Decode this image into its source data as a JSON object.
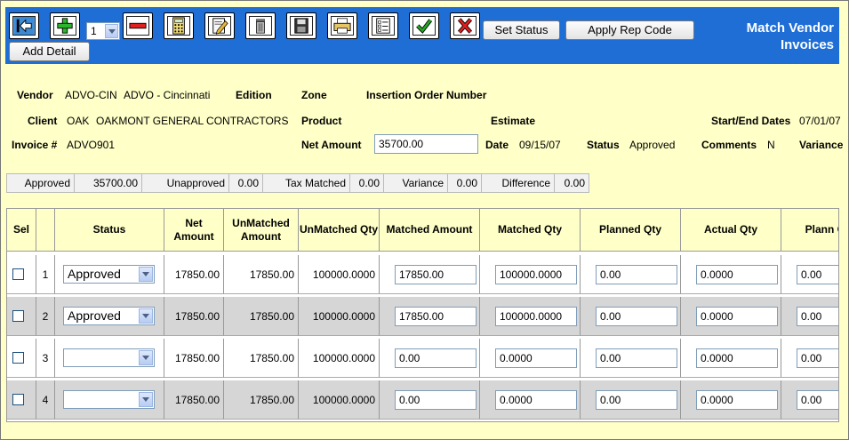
{
  "toolbar": {
    "record_select_value": "1",
    "set_status_label": "Set Status",
    "apply_rep_code_label": "Apply Rep Code",
    "add_detail_label": "Add Detail",
    "title_line1": "Match Vendor",
    "title_line2": "Invoices",
    "icons": [
      "back-arrow-icon",
      "add-icon",
      "record-select",
      "remove-icon",
      "calculator-icon",
      "edit-icon",
      "delete-icon",
      "save-icon",
      "print-icon",
      "checklist-icon",
      "approve-check-icon",
      "reject-x-icon"
    ],
    "accent_color": "#1e6ed6"
  },
  "info": {
    "vendor_label": "Vendor",
    "vendor_code": "ADVO-CIN",
    "vendor_name": "ADVO - Cincinnati",
    "edition_label": "Edition",
    "zone_label": "Zone",
    "ion_label": "Insertion Order Number",
    "client_label": "Client",
    "client_code": "OAK",
    "client_name": "OAKMONT GENERAL CONTRACTORS",
    "product_label": "Product",
    "estimate_label": "Estimate",
    "startend_label": "Start/End Dates",
    "startend_value": "07/01/07",
    "invoice_label": "Invoice #",
    "invoice_value": "ADVO901",
    "net_amount_label": "Net Amount",
    "net_amount_value": "35700.00",
    "date_label": "Date",
    "date_value": "09/15/07",
    "status_label": "Status",
    "status_value": "Approved",
    "comments_label": "Comments",
    "comments_value": "N",
    "variance_label": "Variance"
  },
  "totals": {
    "approved_label": "Approved",
    "approved_value": "35700.00",
    "unapproved_label": "Unapproved",
    "unapproved_value": "0.00",
    "taxmatched_label": "Tax Matched",
    "taxmatched_value": "0.00",
    "variance_label": "Variance",
    "variance_value": "0.00",
    "difference_label": "Difference",
    "difference_value": "0.00"
  },
  "grid": {
    "headers": {
      "sel": "Sel",
      "status": "Status",
      "net_amount": "Net Amount",
      "unmatched_amount": "UnMatched Amount",
      "unmatched_qty": "UnMatched Qty",
      "matched_amount": "Matched Amount",
      "matched_qty": "Matched Qty",
      "planned_qty": "Planned Qty",
      "actual_qty": "Actual Qty",
      "planned_cost": "Plann Cos"
    },
    "rows": [
      {
        "num": "1",
        "status": "Approved",
        "net_amount": "17850.00",
        "unmatched_amount": "17850.00",
        "unmatched_qty": "100000.0000",
        "matched_amount": "17850.00",
        "matched_qty": "100000.0000",
        "planned_qty": "0.00",
        "actual_qty": "0.0000",
        "planned_cost": "0.00"
      },
      {
        "num": "2",
        "status": "Approved",
        "net_amount": "17850.00",
        "unmatched_amount": "17850.00",
        "unmatched_qty": "100000.0000",
        "matched_amount": "17850.00",
        "matched_qty": "100000.0000",
        "planned_qty": "0.00",
        "actual_qty": "0.0000",
        "planned_cost": "0.00"
      },
      {
        "num": "3",
        "status": "",
        "net_amount": "17850.00",
        "unmatched_amount": "17850.00",
        "unmatched_qty": "100000.0000",
        "matched_amount": "0.00",
        "matched_qty": "0.0000",
        "planned_qty": "0.00",
        "actual_qty": "0.0000",
        "planned_cost": "0.00"
      },
      {
        "num": "4",
        "status": "",
        "net_amount": "17850.00",
        "unmatched_amount": "17850.00",
        "unmatched_qty": "100000.0000",
        "matched_amount": "0.00",
        "matched_qty": "0.0000",
        "planned_qty": "0.00",
        "actual_qty": "0.0000",
        "planned_cost": "0.00"
      }
    ]
  }
}
